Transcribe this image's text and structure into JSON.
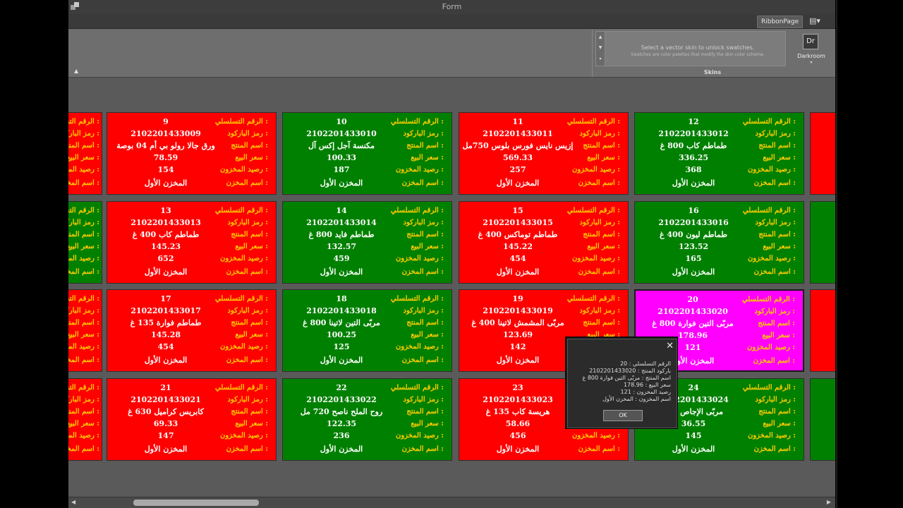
{
  "window": {
    "title": "Form"
  },
  "ribbon": {
    "page_tab": "RibbonPage",
    "layout_button": "▤▾",
    "swatch_message": "Select a vector skin to unlock swatches.",
    "swatch_submessage": "Swatches are color palettes that modify the skin color scheme.",
    "skin_icon_text": "Dr",
    "skin_name": "Darkroom",
    "group_label": "Skins"
  },
  "labels": {
    "serial": "الرقم التسلسلي :",
    "barcode": "رمز الباركود :",
    "product": "اسم المنتج :",
    "price": "سعر البيع :",
    "stock": "رصيد المخزون :",
    "store": "اسم المخزن :"
  },
  "cards": [
    {
      "color": "red",
      "serial": "9",
      "barcode": "2102201433009",
      "product": "ورق جالا رولو بي أم 04 بوصة",
      "price": "78.59",
      "stock": "154",
      "store": "المخزن الأول"
    },
    {
      "color": "red",
      "serial": "13",
      "barcode": "2102201433013",
      "product": "طماطم كاب 400 غ",
      "price": "145.23",
      "stock": "652",
      "store": "المخزن الأول"
    },
    {
      "color": "red",
      "serial": "17",
      "barcode": "2102201433017",
      "product": "طماطم فوارة 135 غ",
      "price": "145.28",
      "stock": "454",
      "store": "المخزن الأول"
    },
    {
      "color": "red",
      "serial": "21",
      "barcode": "2102201433021",
      "product": "كابريس كراميل 630 غ",
      "price": "69.33",
      "stock": "147",
      "store": "المخزن الأول"
    },
    {
      "color": "green",
      "serial": "10",
      "barcode": "2102201433010",
      "product": "مكنسة آجل إكس آل",
      "price": "100.33",
      "stock": "187",
      "store": "المخزن الأول"
    },
    {
      "color": "green",
      "serial": "14",
      "barcode": "2102201433014",
      "product": "طماطم فايد 800 غ",
      "price": "132.57",
      "stock": "459",
      "store": "المخزن الأول"
    },
    {
      "color": "green",
      "serial": "18",
      "barcode": "2102201433018",
      "product": "مربّى التين لاتينا 800 غ",
      "price": "100.25",
      "stock": "125",
      "store": "المخزن الأول"
    },
    {
      "color": "green",
      "serial": "22",
      "barcode": "2102201433022",
      "product": "روح الملح ناصح 720 مل",
      "price": "122.35",
      "stock": "236",
      "store": "المخزن الأول"
    },
    {
      "color": "red",
      "serial": "11",
      "barcode": "2102201433011",
      "product": "إزيس نايس فورس بلوس 750مل",
      "price": "569.33",
      "stock": "257",
      "store": "المخزن الأول"
    },
    {
      "color": "red",
      "serial": "15",
      "barcode": "2102201433015",
      "product": "طماطم توماكس 400 غ",
      "price": "145.22",
      "stock": "454",
      "store": "المخزن الأول"
    },
    {
      "color": "red",
      "serial": "19",
      "barcode": "2102201433019",
      "product": "مربّى المشمش لاتينا 400 غ",
      "price": "123.69",
      "stock": "142",
      "store": "المخزن الأول"
    },
    {
      "color": "red",
      "serial": "23",
      "barcode": "2102201433023",
      "product": "هريسة كاب 135 غ",
      "price": "58.66",
      "stock": "456",
      "store": "المخزن الأول"
    },
    {
      "color": "green",
      "serial": "12",
      "barcode": "2102201433012",
      "product": "طماطم كاب 800 غ",
      "price": "336.25",
      "stock": "368",
      "store": "المخزن الأول"
    },
    {
      "color": "green",
      "serial": "16",
      "barcode": "2102201433016",
      "product": "طماطم ليون 400 غ",
      "price": "123.52",
      "stock": "165",
      "store": "المخزن الأول"
    },
    {
      "color": "magenta",
      "serial": "20",
      "barcode": "2102201433020",
      "product": "مربّى التين فوارة 800 غ",
      "price": "178.96",
      "stock": "121",
      "store": "المخزن الأول"
    },
    {
      "color": "green",
      "serial": "24",
      "barcode": "2102201433024",
      "product": "مربّى الإجاص لاتينا",
      "price": "36.55",
      "stock": "145",
      "store": "المخزن الأول"
    }
  ],
  "partial_left_cards": [
    {
      "color": "red"
    },
    {
      "color": "green"
    },
    {
      "color": "red"
    },
    {
      "color": "red"
    }
  ],
  "partial_right_cards": [
    {
      "color": "red"
    },
    {
      "color": "green"
    },
    {
      "color": "red"
    },
    {
      "color": "green"
    }
  ],
  "popup": {
    "close": "✕",
    "lines": [
      "الرقم التسلسلي : 20",
      "باركود المنتج : 2102201433020",
      "اسم المنتج : مربّى التين فوارة 800 غ",
      "سعر البيع : 178.96",
      "رصيد المخزون : 121",
      "اسم المخزون : المخزن الأول"
    ],
    "ok": "OK"
  }
}
